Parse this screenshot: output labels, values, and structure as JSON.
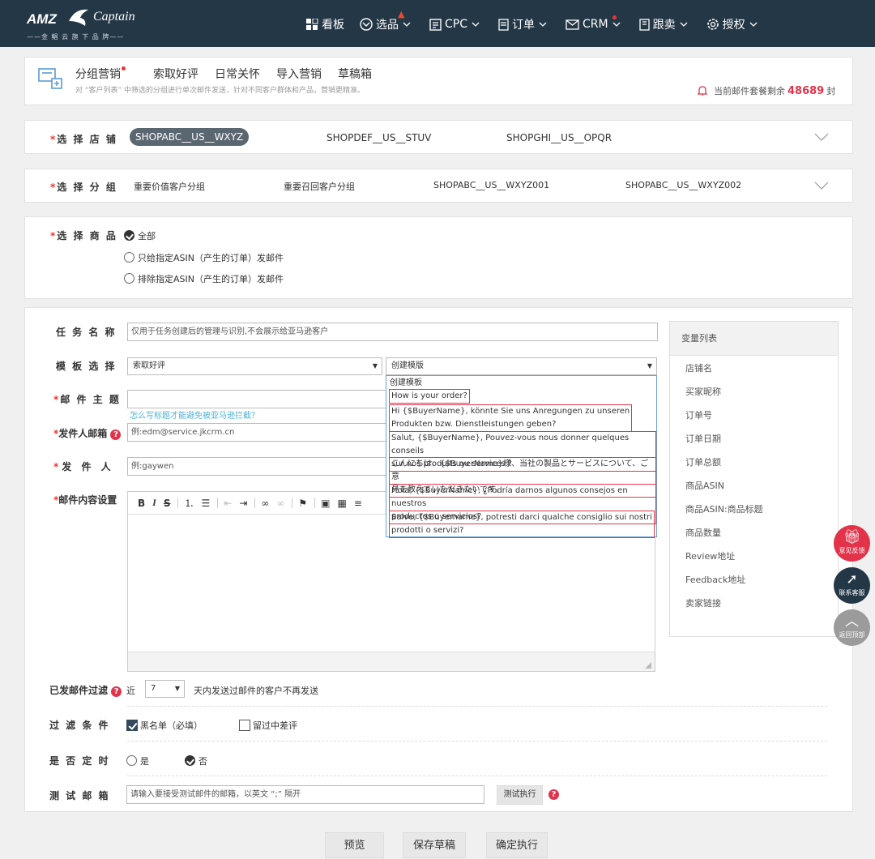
{
  "brand": {
    "line1": "AMZ",
    "line2": "Captain",
    "tagline": "——金 鲳 云 旗 下 品 牌——"
  },
  "nav": [
    "看板",
    "选品",
    "CPC",
    "订单",
    "CRM",
    "跟卖",
    "授权"
  ],
  "tabs": [
    "分组营销",
    "索取好评",
    "日常关怀",
    "导入营销",
    "草稿箱"
  ],
  "tip": "对 “客户列表” 中筛选的分组进行单次邮件发送，针对不同客户群体和产品，营销更精准。",
  "quota": {
    "prefix": "当前邮件套餐剩余",
    "value": "48689",
    "unit": "封"
  },
  "shop": {
    "label": "选 择 店 铺",
    "star": "*",
    "items": [
      "SHOPABC__US__WXYZ",
      "SHOPDEF__US__STUV",
      "SHOPGHI__US__OPQR"
    ]
  },
  "group": {
    "label": "选 择 分 组",
    "star": "*",
    "items": [
      "重要价值客户分组",
      "重要召回客户分组",
      "SHOPABC__US__WXYZ001",
      "SHOPABC__US__WXYZ002"
    ]
  },
  "product": {
    "label": "选 择 商 品",
    "star": "*",
    "options": [
      "全部",
      "只给指定ASIN（产生的订单）发邮件",
      "排除指定ASIN（产生的订单）发邮件"
    ]
  },
  "form": {
    "task_label": "任 务 名 称",
    "task_placeholder": "仅用于任务创建后的管理与识别,不会展示给亚马逊客户",
    "template_label": "模 板 选 择",
    "template_type": "索取好评",
    "template_select": "创建模版",
    "subject_label": "邮 件 主 题",
    "subject_help": "怎么写标题才能避免被亚马逊拦截？",
    "sender_email_label": "发件人邮箱",
    "sender_email_placeholder": "例:edm@service.jkcrm.cn",
    "sender_label": "发  件  人",
    "sender_placeholder": "例:gaywen",
    "content_label": "邮件内容设置"
  },
  "dropdown": [
    "创建模板",
    "How is your order?",
    "Hi {$BuyerName}, könnte Sie uns Anregungen zu unseren",
    "Produkten bzw. Dienstleistungen geben?",
    "Salut, {$BuyerName}, Pouvez-vous nous donner quelques conseils",
    "sur nos produits ou services ?",
    "こんにちは、{$BuyerName}様、当社の製品とサービスについて、ご意",
    "見を教えていただきたいです。",
    "Hola, {$BuyerName}, ¿Podría darnos algunos consejos en nuestros",
    "productos o servicios?",
    "Salve, {$Buyername}, potresti darci qualche consiglio sui nostri",
    "prodotti o servizi?"
  ],
  "vars": {
    "title": "变量列表",
    "items": [
      "店铺名",
      "买家昵称",
      "订单号",
      "订单日期",
      "订单总额",
      "商品ASIN",
      "商品ASIN:商品标题",
      "商品数量",
      "Review地址",
      "Feedback地址",
      "卖家链接"
    ]
  },
  "filter": {
    "label": "已发邮件过滤",
    "near": "近",
    "days": "7",
    "desc": "天内发送过邮件的客户不再发送"
  },
  "conditions": {
    "label": "过 滤 条 件",
    "blacklist": "黑名单（必填）",
    "badreview": "留过中差评"
  },
  "timed": {
    "label": "是 否 定 时",
    "yes": "是",
    "no": "否"
  },
  "test": {
    "label": "测 试 邮 箱",
    "placeholder": "请输入要接受测试邮件的邮箱，以英文 “;” 隔开",
    "button": "测试执行"
  },
  "buttons": [
    "预览",
    "保存草稿",
    "确定执行"
  ],
  "floats": [
    "意见反馈",
    "联系客服",
    "返回顶部"
  ]
}
